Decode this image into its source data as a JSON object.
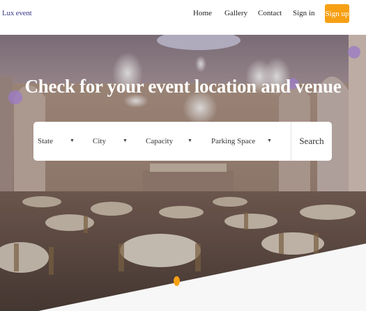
{
  "brand": {
    "logo_text": "Lux event"
  },
  "nav": {
    "links": [
      {
        "label": "Home"
      },
      {
        "label": "Gallery"
      },
      {
        "label": "Contact"
      },
      {
        "label": "Sign in"
      }
    ],
    "signup_label": "Sign up"
  },
  "hero": {
    "title": "Check for your event location and venue",
    "filters": [
      {
        "label": "State",
        "icon": "caret-down-icon"
      },
      {
        "label": "City",
        "icon": "caret-down-icon"
      },
      {
        "label": "Capacity",
        "icon": "caret-down-icon"
      },
      {
        "label": "Parking Space",
        "icon": "caret-down-icon"
      }
    ],
    "search_label": "Search"
  },
  "colors": {
    "accent": "#f7a014",
    "logo": "#3a3a8c"
  }
}
